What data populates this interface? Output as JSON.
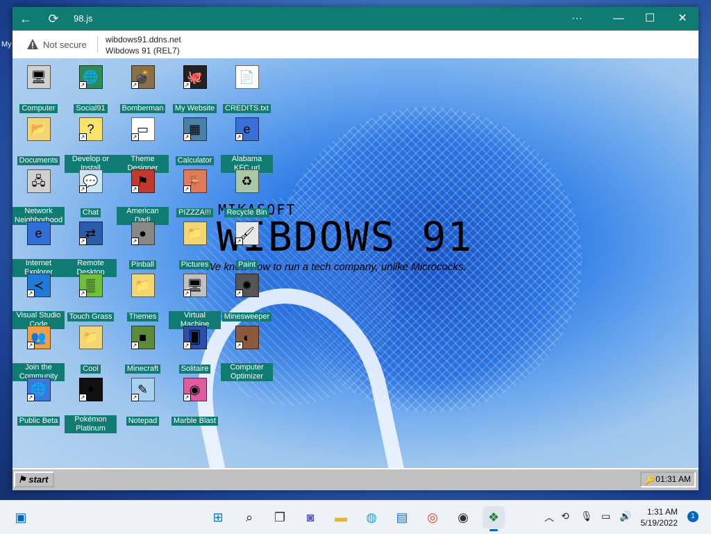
{
  "outer_desktop": {
    "edge_text": "My"
  },
  "window": {
    "title": "98.js",
    "address": {
      "security": "Not secure",
      "url": "wibdows91.ddns.net",
      "page_title": "Wibdows 91 (REL7)"
    },
    "controls": {
      "more": "···",
      "minimize": "—",
      "maximize": "☐",
      "close": "✕"
    }
  },
  "branding": {
    "maker": "MIKASOFT",
    "product": "WIBDOWS 91",
    "tagline": "We know how to run a tech company, unlike Micrococks."
  },
  "desktop_icons": [
    {
      "label": "Computer",
      "icon": "computer-icon",
      "glyph": "🖥",
      "color": "#d0d0d0",
      "shortcut": false
    },
    {
      "label": "Social91",
      "icon": "globe-icon",
      "glyph": "🌐",
      "color": "#2e8b57",
      "shortcut": true
    },
    {
      "label": "Bomberman",
      "icon": "bomberman-icon",
      "glyph": "💣",
      "color": "#8b6f47",
      "shortcut": true
    },
    {
      "label": "My Website",
      "icon": "github-icon",
      "glyph": "🐙",
      "color": "#222222",
      "shortcut": true
    },
    {
      "label": "CREDITS.txt",
      "icon": "text-file-icon",
      "glyph": "📄",
      "color": "#ffffff",
      "shortcut": false
    },
    {
      "label": "Documents",
      "icon": "folder-documents-icon",
      "glyph": "📂",
      "color": "#f2d675",
      "shortcut": false
    },
    {
      "label": "Develop or Install",
      "icon": "help-icon",
      "glyph": "?",
      "color": "#f7e36b",
      "shortcut": true
    },
    {
      "label": "Theme Designer",
      "icon": "window-icon",
      "glyph": "▭",
      "color": "#ffffff",
      "shortcut": true
    },
    {
      "label": "Calculator",
      "icon": "calculator-icon",
      "glyph": "▦",
      "color": "#4a7fa8",
      "shortcut": true
    },
    {
      "label": "Alabama KFC.url",
      "icon": "ie-link-icon",
      "glyph": "e",
      "color": "#3b6fd8",
      "shortcut": true
    },
    {
      "label": "Network Neighborhood",
      "icon": "network-icon",
      "glyph": "🖧",
      "color": "#d0d0d0",
      "shortcut": false
    },
    {
      "label": "Chat",
      "icon": "chat-bubble-icon",
      "glyph": "💬",
      "color": "#cde4f7",
      "shortcut": true
    },
    {
      "label": "American Dad!",
      "icon": "us-flag-icon",
      "glyph": "⚑",
      "color": "#c0392b",
      "shortcut": true
    },
    {
      "label": "PIZZZA!!!",
      "icon": "chair-icon",
      "glyph": "🪑",
      "color": "#e07a5a",
      "shortcut": true
    },
    {
      "label": "Recycle Bin",
      "icon": "recycle-bin-icon",
      "glyph": "♻",
      "color": "#a8c8a8",
      "shortcut": false
    },
    {
      "label": "Internet Explorer",
      "icon": "internet-explorer-icon",
      "glyph": "e",
      "color": "#2f6fd6",
      "shortcut": false
    },
    {
      "label": "Remote Desktop",
      "icon": "remote-desktop-icon",
      "glyph": "⇄",
      "color": "#2a5caa",
      "shortcut": true
    },
    {
      "label": "Pinball",
      "icon": "pinball-icon",
      "glyph": "●",
      "color": "#888888",
      "shortcut": true
    },
    {
      "label": "Pictures",
      "icon": "folder-pictures-icon",
      "glyph": "📁",
      "color": "#f2d675",
      "shortcut": false
    },
    {
      "label": "Paint",
      "icon": "paint-icon",
      "glyph": "🖌",
      "color": "#e8e8e8",
      "shortcut": true
    },
    {
      "label": "Visual Studio Code",
      "icon": "vscode-icon",
      "glyph": "≺",
      "color": "#1f7ad6",
      "shortcut": true
    },
    {
      "label": "Touch Grass",
      "icon": "grass-icon",
      "glyph": "▒",
      "color": "#6fbf3a",
      "shortcut": true
    },
    {
      "label": "Themes",
      "icon": "folder-themes-icon",
      "glyph": "📁",
      "color": "#f2d675",
      "shortcut": false
    },
    {
      "label": "Virtual Machine",
      "icon": "virtual-machine-icon",
      "glyph": "🖥",
      "color": "#c0c0c0",
      "shortcut": true
    },
    {
      "label": "Minesweeper",
      "icon": "minesweeper-icon",
      "glyph": "✹",
      "color": "#555555",
      "shortcut": true
    },
    {
      "label": "Join the Community",
      "icon": "community-icon",
      "glyph": "👥",
      "color": "#f0a040",
      "shortcut": true
    },
    {
      "label": "Cool",
      "icon": "folder-cool-icon",
      "glyph": "📁",
      "color": "#f2d675",
      "shortcut": false
    },
    {
      "label": "Minecraft",
      "icon": "minecraft-icon",
      "glyph": "■",
      "color": "#5b8c3a",
      "shortcut": true
    },
    {
      "label": "Solitaire",
      "icon": "solitaire-icon",
      "glyph": "🂠",
      "color": "#2b4fa8",
      "shortcut": true
    },
    {
      "label": "Computer Optimizer",
      "icon": "optimizer-icon",
      "glyph": "◐",
      "color": "#8a5a3a",
      "shortcut": true
    },
    {
      "label": "Public Beta",
      "icon": "public-beta-icon",
      "glyph": "🌐",
      "color": "#3a7ad6",
      "shortcut": true
    },
    {
      "label": "Pokémon Platinum",
      "icon": "pokemon-icon",
      "glyph": "✦",
      "color": "#111111",
      "shortcut": true
    },
    {
      "label": "Notepad",
      "icon": "notepad-icon",
      "glyph": "✎",
      "color": "#a8d0f0",
      "shortcut": true
    },
    {
      "label": "Marble Blast",
      "icon": "marble-icon",
      "glyph": "◉",
      "color": "#e05aa0",
      "shortcut": true
    }
  ],
  "inner_taskbar": {
    "start_label": "start",
    "clock": "01:31 AM"
  },
  "win_taskbar": {
    "apps": [
      {
        "name": "widgets-icon",
        "glyph": "▣",
        "color": "#0067c0"
      },
      {
        "name": "start-icon",
        "glyph": "⊞",
        "color": "#0078d4"
      },
      {
        "name": "search-icon",
        "glyph": "⌕",
        "color": "#222222"
      },
      {
        "name": "taskview-icon",
        "glyph": "❐",
        "color": "#333333"
      },
      {
        "name": "chat-icon",
        "glyph": "◙",
        "color": "#5b5fc7"
      },
      {
        "name": "explorer-icon",
        "glyph": "▬",
        "color": "#e8b33b"
      },
      {
        "name": "edge-icon",
        "glyph": "◍",
        "color": "#1fa2d6"
      },
      {
        "name": "store-icon",
        "glyph": "▤",
        "color": "#1f6fd6"
      },
      {
        "name": "chrome-icon",
        "glyph": "◎",
        "color": "#d9402b"
      },
      {
        "name": "obs-icon",
        "glyph": "◉",
        "color": "#303030"
      },
      {
        "name": "app98-icon",
        "glyph": "❖",
        "color": "#2e7d3a"
      }
    ],
    "time": "1:31 AM",
    "date": "5/19/2022",
    "notifications": "1"
  }
}
